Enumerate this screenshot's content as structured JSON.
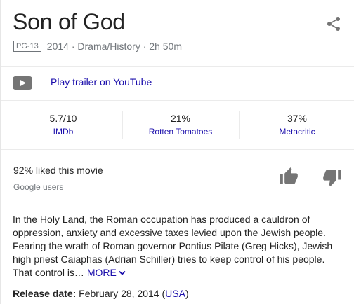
{
  "header": {
    "title": "Son of God",
    "content_rating": "PG-13",
    "meta": "2014 · Drama/History · 2h 50m",
    "share_icon": "share-icon"
  },
  "trailer": {
    "icon": "youtube-play-icon",
    "label": "Play trailer on YouTube"
  },
  "scores": [
    {
      "value": "5.7/10",
      "source": "IMDb"
    },
    {
      "value": "21%",
      "source": "Rotten Tomatoes"
    },
    {
      "value": "37%",
      "source": "Metacritic"
    }
  ],
  "audience": {
    "liked": "92% liked this movie",
    "source": "Google users",
    "like_icon": "thumbs-up-icon",
    "dislike_icon": "thumbs-down-icon"
  },
  "description": {
    "text": "In the Holy Land, the Roman occupation has produced a cauldron of oppression, anxiety and excessive taxes levied upon the Jewish people. Fearing the wrath of Roman governor Pontius Pilate (Greg Hicks), Jewish high priest Caiaphas (Adrian Schiller) tries to keep control of his people. That control is…",
    "more_label": "MORE"
  },
  "release": {
    "label": "Release date:",
    "date": "February 28, 2014",
    "region_open": "(",
    "region": "USA",
    "region_close": ")"
  },
  "colors": {
    "link": "#1a0dab",
    "muted": "#70757a",
    "icon_grey": "#757575",
    "divider": "#ebebeb"
  }
}
